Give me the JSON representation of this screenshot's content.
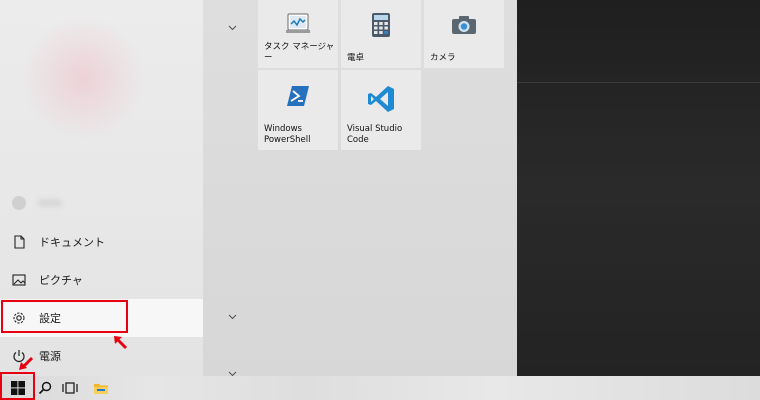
{
  "start_menu": {
    "left_items": [
      {
        "label": "",
        "icon": "user-icon"
      },
      {
        "label": "ドキュメント",
        "icon": "document-icon"
      },
      {
        "label": "ピクチャ",
        "icon": "picture-icon"
      },
      {
        "label": "設定",
        "icon": "gear-icon"
      },
      {
        "label": "電源",
        "icon": "power-icon"
      }
    ],
    "tiles": [
      {
        "label": "タスク マネージャー",
        "icon": "task-manager-icon"
      },
      {
        "label": "電卓",
        "icon": "calculator-icon"
      },
      {
        "label": "カメラ",
        "icon": "camera-icon"
      },
      {
        "label": "Windows\nPowerShell",
        "icon": "powershell-icon"
      },
      {
        "label": "Visual Studio\nCode",
        "icon": "vscode-icon"
      }
    ]
  },
  "taskbar": {
    "items": [
      "windows-start-icon",
      "search-icon",
      "task-view-icon",
      "file-explorer-icon"
    ]
  },
  "colors": {
    "highlight": "#e60012",
    "accent": "#0078d7"
  }
}
